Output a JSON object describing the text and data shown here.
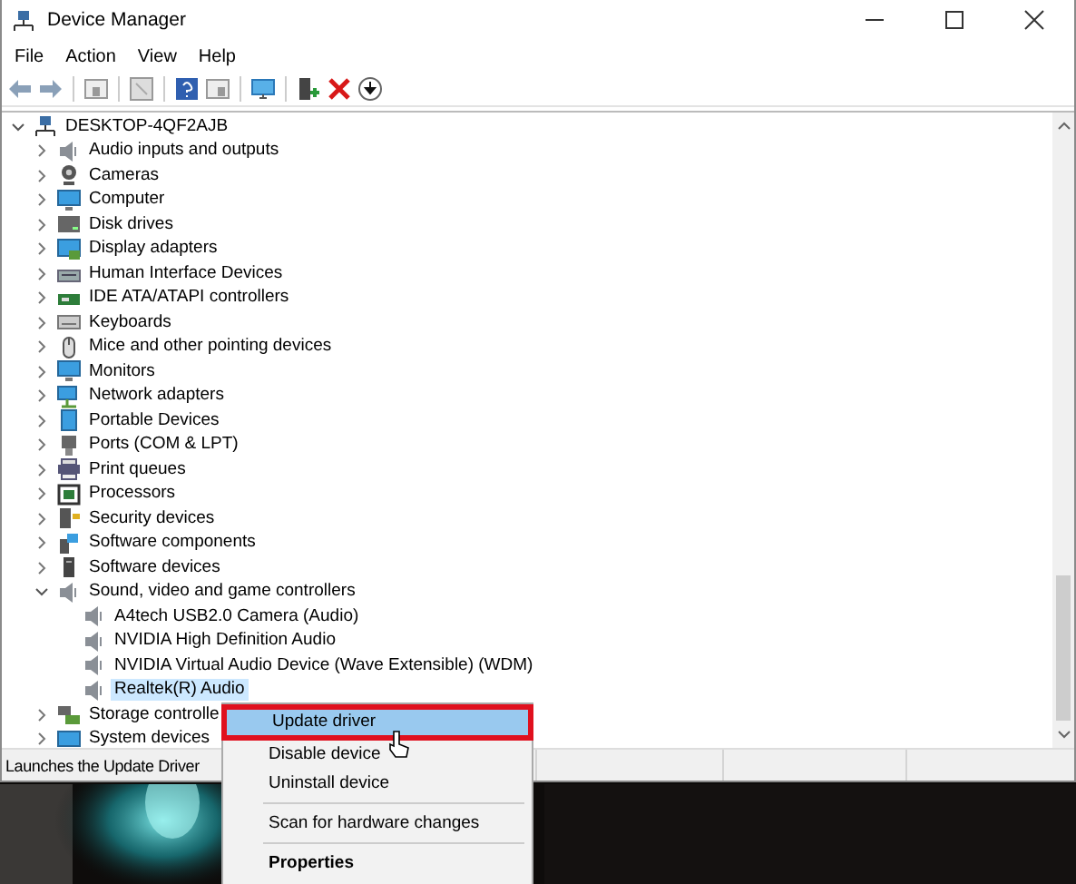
{
  "window": {
    "title": "Device Manager"
  },
  "menu_bar": [
    "File",
    "Action",
    "View",
    "Help"
  ],
  "tree": {
    "label": "DESKTOP-4QF2AJB",
    "expanded": true,
    "children": [
      {
        "label": "Audio inputs and outputs",
        "expanded": false,
        "selected": false
      },
      {
        "label": "Cameras",
        "expanded": false,
        "selected": false
      },
      {
        "label": "Computer",
        "expanded": false,
        "selected": false
      },
      {
        "label": "Disk drives",
        "expanded": false,
        "selected": false
      },
      {
        "label": "Display adapters",
        "expanded": false,
        "selected": false
      },
      {
        "label": "Human Interface Devices",
        "expanded": false,
        "selected": false
      },
      {
        "label": "IDE ATA/ATAPI controllers",
        "expanded": false,
        "selected": false
      },
      {
        "label": "Keyboards",
        "expanded": false,
        "selected": false
      },
      {
        "label": "Mice and other pointing devices",
        "expanded": false,
        "selected": false
      },
      {
        "label": "Monitors",
        "expanded": false,
        "selected": false
      },
      {
        "label": "Network adapters",
        "expanded": false,
        "selected": false
      },
      {
        "label": "Portable Devices",
        "expanded": false,
        "selected": false
      },
      {
        "label": "Ports (COM & LPT)",
        "expanded": false,
        "selected": false
      },
      {
        "label": "Print queues",
        "expanded": false,
        "selected": false
      },
      {
        "label": "Processors",
        "expanded": false,
        "selected": false
      },
      {
        "label": "Security devices",
        "expanded": false,
        "selected": false
      },
      {
        "label": "Software components",
        "expanded": false,
        "selected": false
      },
      {
        "label": "Software devices",
        "expanded": false,
        "selected": false
      },
      {
        "label": "Sound, video and game controllers",
        "expanded": true,
        "selected": false,
        "children": [
          {
            "label": "A4tech USB2.0 Camera (Audio)",
            "selected": false
          },
          {
            "label": "NVIDIA High Definition Audio",
            "selected": false
          },
          {
            "label": "NVIDIA Virtual Audio Device (Wave Extensible) (WDM)",
            "selected": false
          },
          {
            "label": "Realtek(R) Audio",
            "selected": true
          }
        ]
      },
      {
        "label": "Storage controlle",
        "expanded": false,
        "selected": false
      },
      {
        "label": "System devices",
        "expanded": false,
        "selected": false
      }
    ]
  },
  "status_bar": {
    "text": "Launches the Update Driver"
  },
  "context_menu": {
    "items": [
      {
        "kind": "item",
        "label": "Update driver",
        "selected": true,
        "highlighted": true
      },
      {
        "kind": "item",
        "label": "Disable device",
        "selected": false,
        "highlighted": false
      },
      {
        "kind": "item",
        "label": "Uninstall device",
        "selected": false,
        "highlighted": false
      },
      {
        "kind": "separator"
      },
      {
        "kind": "item",
        "label": "Scan for hardware changes",
        "selected": false,
        "highlighted": false
      },
      {
        "kind": "separator"
      },
      {
        "kind": "default",
        "label": "Properties",
        "selected": false,
        "highlighted": false
      }
    ]
  }
}
